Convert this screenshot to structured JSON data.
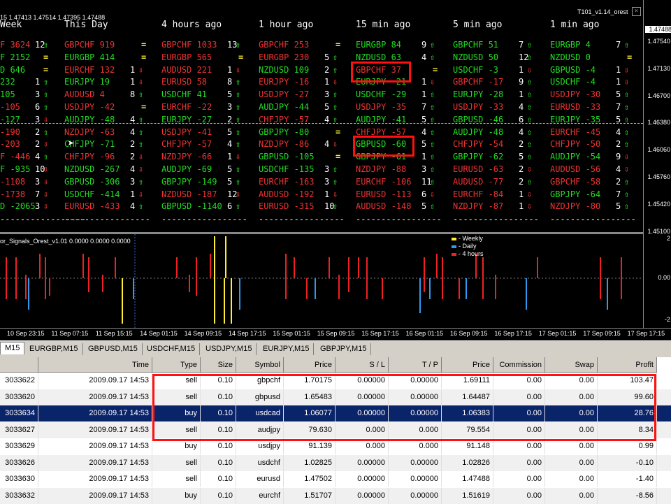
{
  "chart": {
    "quote_header": "15  1.47413 1.47514 1.47395 1.47488",
    "ea_name": "T101_v1.14_orest",
    "price_scale": [
      "1.47540",
      "1.47130",
      "1.46700",
      "1.46380",
      "1.46060",
      "1.45760",
      "1.45420",
      "1.45100"
    ],
    "current_price": "1.47488",
    "columns": [
      {
        "header": "Week",
        "rows": [
          {
            "pair": "F 3624",
            "dir": "down",
            "cnt": "12",
            "arrow": "up"
          },
          {
            "pair": "F 2152",
            "dir": "up",
            "cnt": "",
            "arrow": "eq"
          },
          {
            "pair": "D 646",
            "dir": "up",
            "cnt": "",
            "arrow": "eq"
          },
          {
            "pair": "232",
            "dir": "up",
            "cnt": "1",
            "arrow": "up"
          },
          {
            "pair": "105",
            "dir": "up",
            "cnt": "3",
            "arrow": "up"
          },
          {
            "pair": "-105",
            "dir": "down",
            "cnt": "6",
            "arrow": "up"
          },
          {
            "pair": "-127",
            "dbx": "",
            "dir": "up",
            "cnt": "3",
            "arrow": "down"
          },
          {
            "pair": "-190",
            "dir": "down",
            "cnt": "2",
            "arrow": "up"
          },
          {
            "pair": "-203",
            "dir": "down",
            "cnt": "2",
            "arrow": "down"
          },
          {
            "pair": "F -446",
            "dir": "down",
            "cnt": "4",
            "arrow": "up"
          },
          {
            "pair": "F -935",
            "dir": "up",
            "cnt": "10",
            "arrow": "down"
          },
          {
            "pair": "-1108",
            "dir": "down",
            "cnt": "3",
            "arrow": "down"
          },
          {
            "pair": "-1738",
            "dir": "down",
            "cnt": "7",
            "arrow": "down"
          },
          {
            "pair": "D -2065",
            "dir": "up",
            "cnt": "3",
            "arrow": "down"
          }
        ]
      },
      {
        "header": "This Day",
        "rows": [
          {
            "pair": "GBPCHF 919",
            "dir": "down",
            "cnt": "",
            "arrow": "eq"
          },
          {
            "pair": "EURGBP 414",
            "dir": "up",
            "cnt": "",
            "arrow": "eq"
          },
          {
            "pair": "EURCHF 132",
            "dir": "down",
            "cnt": "1",
            "arrow": "down"
          },
          {
            "pair": "EURJPY 19",
            "dir": "up",
            "cnt": "1",
            "arrow": "down"
          },
          {
            "pair": "AUDUSD 4",
            "dir": "down",
            "cnt": "8",
            "arrow": "up"
          },
          {
            "pair": "USDJPY -42",
            "dir": "down",
            "cnt": "",
            "arrow": "eq"
          },
          {
            "pair": "AUDJPY -48",
            "dir": "up",
            "cnt": "4",
            "arrow": "up"
          },
          {
            "pair": "NZDJPY -63",
            "dir": "down",
            "cnt": "4",
            "arrow": "up"
          },
          {
            "pair": "CHFJPY -71",
            "dir": "up",
            "cnt": "2",
            "arrow": "up"
          },
          {
            "pair": "CHFJPY -96",
            "dir": "down",
            "cnt": "2",
            "arrow": "down"
          },
          {
            "pair": "NZDUSD -267",
            "dir": "up",
            "cnt": "4",
            "arrow": "down"
          },
          {
            "pair": "GBPUSD -306",
            "dir": "up",
            "cnt": "3",
            "arrow": "up"
          },
          {
            "pair": "USDCHF -414",
            "dir": "up",
            "cnt": "1",
            "arrow": "down"
          },
          {
            "pair": "EURUSD -433",
            "dir": "down",
            "cnt": "4",
            "arrow": "up"
          }
        ]
      },
      {
        "header": "4 hours ago",
        "rows": [
          {
            "pair": "GBPCHF 1033",
            "dir": "down",
            "cnt": "13",
            "arrow": "up"
          },
          {
            "pair": "EURGBP 565",
            "dir": "down",
            "cnt": "",
            "arrow": "eq"
          },
          {
            "pair": "AUDUSD 221",
            "dir": "down",
            "cnt": "1",
            "arrow": "down"
          },
          {
            "pair": "EURUSD 58",
            "dir": "down",
            "cnt": "8",
            "arrow": "up"
          },
          {
            "pair": "USDCHF 41",
            "dir": "up",
            "cnt": "5",
            "arrow": "up"
          },
          {
            "pair": "EURCHF -22",
            "dir": "down",
            "cnt": "3",
            "arrow": "up"
          },
          {
            "pair": "EURJPY -27",
            "dir": "up",
            "cnt": "2",
            "arrow": "up"
          },
          {
            "pair": "USDJPY -41",
            "dir": "down",
            "cnt": "5",
            "arrow": "up"
          },
          {
            "pair": "CHFJPY -57",
            "dir": "down",
            "cnt": "4",
            "arrow": "up"
          },
          {
            "pair": "NZDJPY -66",
            "dir": "down",
            "cnt": "1",
            "arrow": "down"
          },
          {
            "pair": "AUDJPY -69",
            "dir": "up",
            "cnt": "5",
            "arrow": "up"
          },
          {
            "pair": "GBPJPY -149",
            "dir": "up",
            "cnt": "5",
            "arrow": "up"
          },
          {
            "pair": "NZDUSD -187",
            "dir": "down",
            "cnt": "12",
            "arrow": "down"
          },
          {
            "pair": "GBPUSD -1140",
            "dir": "up",
            "cnt": "6",
            "arrow": "up"
          }
        ]
      },
      {
        "header": "1 hour ago",
        "rows": [
          {
            "pair": "GBPCHF 253",
            "dir": "down",
            "cnt": "",
            "arrow": "eq"
          },
          {
            "pair": "EURGBP 230",
            "dir": "down",
            "cnt": "5",
            "arrow": "up"
          },
          {
            "pair": "NZDUSD 109",
            "dir": "up",
            "cnt": "2",
            "arrow": "up"
          },
          {
            "pair": "EURJPY -16",
            "dir": "down",
            "cnt": "1",
            "arrow": "down"
          },
          {
            "pair": "USDJPY -27",
            "dir": "down",
            "cnt": "3",
            "arrow": "up"
          },
          {
            "pair": "AUDJPY -44",
            "dir": "up",
            "cnt": "5",
            "arrow": "up"
          },
          {
            "pair": "CHFJPY -57",
            "dir": "down",
            "cnt": "4",
            "arrow": "up"
          },
          {
            "pair": "GBPJPY -80",
            "dir": "up",
            "cnt": "",
            "arrow": "eq"
          },
          {
            "pair": "NZDJPY -86",
            "dir": "down",
            "cnt": "4",
            "arrow": "down"
          },
          {
            "pair": "GBPUSD -105",
            "dir": "up",
            "cnt": "",
            "arrow": "eq"
          },
          {
            "pair": "USDCHF -135",
            "dir": "up",
            "cnt": "3",
            "arrow": "up"
          },
          {
            "pair": "EURCHF -163",
            "dir": "down",
            "cnt": "3",
            "arrow": "up"
          },
          {
            "pair": "AUDUSD -192",
            "dir": "down",
            "cnt": "1",
            "arrow": "down"
          },
          {
            "pair": "EURUSD -315",
            "dir": "down",
            "cnt": "10",
            "arrow": "up"
          }
        ]
      },
      {
        "header": "15 min ago",
        "rows": [
          {
            "pair": "EURGBP 84",
            "dir": "up",
            "cnt": "9",
            "arrow": "up"
          },
          {
            "pair": "NZDUSD 63",
            "dir": "up",
            "cnt": "4",
            "arrow": "up"
          },
          {
            "pair": "GBPCHF 37",
            "dir": "down",
            "cnt": "",
            "arrow": "eq"
          },
          {
            "pair": "EURJPY -21",
            "dir": "up",
            "cnt": "1",
            "arrow": "down"
          },
          {
            "pair": "USDCHF -29",
            "dir": "up",
            "cnt": "1",
            "arrow": "up"
          },
          {
            "pair": "USDJPY -35",
            "dir": "down",
            "cnt": "7",
            "arrow": "up"
          },
          {
            "pair": "AUDJPY -41",
            "dir": "up",
            "cnt": "5",
            "arrow": "up"
          },
          {
            "pair": "CHFJPY -57",
            "dir": "down",
            "cnt": "4",
            "arrow": "up"
          },
          {
            "pair": "GBPUSD -60",
            "dir": "up",
            "cnt": "5",
            "arrow": "up"
          },
          {
            "pair": "GBPJPY -61",
            "dir": "up",
            "cnt": "1",
            "arrow": "up"
          },
          {
            "pair": "NZDJPY -88",
            "dir": "down",
            "cnt": "3",
            "arrow": "up"
          },
          {
            "pair": "EURCHF -106",
            "dir": "down",
            "cnt": "11",
            "arrow": "up"
          },
          {
            "pair": "EURUSD -113",
            "dir": "down",
            "cnt": "6",
            "arrow": "down"
          },
          {
            "pair": "AUDUSD -148",
            "dir": "down",
            "cnt": "5",
            "arrow": "up"
          }
        ]
      },
      {
        "header": "5 min ago",
        "rows": [
          {
            "pair": "GBPCHF 51",
            "dir": "up",
            "cnt": "7",
            "arrow": "up"
          },
          {
            "pair": "NZDUSD 50",
            "dir": "up",
            "cnt": "12",
            "arrow": "up"
          },
          {
            "pair": "USDCHF -3",
            "dir": "up",
            "cnt": "1",
            "arrow": "down"
          },
          {
            "pair": "GBPCHF -17",
            "dir": "down",
            "cnt": "9",
            "arrow": "up"
          },
          {
            "pair": "EURJPY -28",
            "dir": "up",
            "cnt": "1",
            "arrow": "up"
          },
          {
            "pair": "USDJPY -33",
            "dir": "down",
            "cnt": "4",
            "arrow": "up"
          },
          {
            "pair": "GBPUSD -46",
            "dir": "up",
            "cnt": "6",
            "arrow": "up"
          },
          {
            "pair": "AUDJPY -48",
            "dir": "up",
            "cnt": "4",
            "arrow": "up"
          },
          {
            "pair": "CHFJPY -54",
            "dir": "down",
            "cnt": "2",
            "arrow": "up"
          },
          {
            "pair": "GBPJPY -62",
            "dir": "up",
            "cnt": "5",
            "arrow": "up"
          },
          {
            "pair": "EURUSD -63",
            "dir": "down",
            "cnt": "2",
            "arrow": "down"
          },
          {
            "pair": "AUDUSD -77",
            "dir": "down",
            "cnt": "2",
            "arrow": "up"
          },
          {
            "pair": "EURCHF -84",
            "dir": "down",
            "cnt": "1",
            "arrow": "down"
          },
          {
            "pair": "NZDJPY -87",
            "dir": "down",
            "cnt": "1",
            "arrow": "down"
          }
        ]
      },
      {
        "header": "1 min ago",
        "rows": [
          {
            "pair": "EURGBP 4",
            "dir": "up",
            "cnt": "7",
            "arrow": "up"
          },
          {
            "pair": "NZDUSD 0",
            "dir": "up",
            "cnt": "",
            "arrow": "eq"
          },
          {
            "pair": "GBPUSD -4",
            "dir": "up",
            "cnt": "1",
            "arrow": "down"
          },
          {
            "pair": "USDCHF -4",
            "dir": "up",
            "cnt": "1",
            "arrow": "down"
          },
          {
            "pair": "USDJPY -30",
            "dir": "down",
            "cnt": "5",
            "arrow": "up"
          },
          {
            "pair": "EURUSD -33",
            "dir": "down",
            "cnt": "7",
            "arrow": "up"
          },
          {
            "pair": "EURJPY -35",
            "dir": "up",
            "cnt": "5",
            "arrow": "up"
          },
          {
            "pair": "EURCHF -45",
            "dir": "down",
            "cnt": "4",
            "arrow": "up"
          },
          {
            "pair": "CHFJPY -50",
            "dir": "down",
            "cnt": "2",
            "arrow": "up"
          },
          {
            "pair": "AUDJPY -54",
            "dir": "up",
            "cnt": "9",
            "arrow": "down"
          },
          {
            "pair": "AUDUSD -56",
            "dir": "down",
            "cnt": "4",
            "arrow": "down"
          },
          {
            "pair": "GBPCHF -58",
            "dir": "down",
            "cnt": "2",
            "arrow": "up"
          },
          {
            "pair": "GBPJPY -64",
            "dir": "up",
            "cnt": "7",
            "arrow": "up"
          },
          {
            "pair": "NZDJPY -80",
            "dir": "down",
            "cnt": "5",
            "arrow": "up"
          }
        ]
      }
    ],
    "dashes": "-----------------"
  },
  "indicator": {
    "title": "or_Signals_Orest_v1.01 0.0000 0.0000 0.0000",
    "legend": [
      {
        "label": "- Weekly",
        "color": "#ffee33"
      },
      {
        "label": "- Daily",
        "color": "#3399ee"
      },
      {
        "label": "- 4 hours",
        "color": "#ee2222"
      }
    ],
    "scale": [
      "2",
      "0.00",
      "-2"
    ]
  },
  "time_axis": [
    "10 Sep 23:15",
    "11 Sep 07:15",
    "11 Sep 15:15",
    "14 Sep 01:15",
    "14 Sep 09:15",
    "14 Sep 17:15",
    "15 Sep 01:15",
    "15 Sep 09:15",
    "15 Sep 17:15",
    "16 Sep 01:15",
    "16 Sep 09:15",
    "16 Sep 17:15",
    "17 Sep 01:15",
    "17 Sep 09:15",
    "17 Sep 17:15"
  ],
  "tabs": [
    "M15",
    "EURGBP,M15",
    "GBPUSD,M15",
    "USDCHF,M15",
    "USDJPY,M15",
    "EURJPY,M15",
    "GBPJPY,M15"
  ],
  "orders": {
    "headers": [
      "",
      "Time",
      "Type",
      "Size",
      "Symbol",
      "Price",
      "S / L",
      "T / P",
      "Price",
      "Commission",
      "Swap",
      "Profit"
    ],
    "rows": [
      [
        "3033622",
        "2009.09.17 14:53",
        "sell",
        "0.10",
        "gbpchf",
        "1.70175",
        "0.00000",
        "0.00000",
        "1.69111",
        "0.00",
        "0.00",
        "103.47"
      ],
      [
        "3033620",
        "2009.09.17 14:53",
        "sell",
        "0.10",
        "gbpusd",
        "1.65483",
        "0.00000",
        "0.00000",
        "1.64487",
        "0.00",
        "0.00",
        "99.60"
      ],
      [
        "3033634",
        "2009.09.17 14:53",
        "buy",
        "0.10",
        "usdcad",
        "1.06077",
        "0.00000",
        "0.00000",
        "1.06383",
        "0.00",
        "0.00",
        "28.76"
      ],
      [
        "3033627",
        "2009.09.17 14:53",
        "sell",
        "0.10",
        "audjpy",
        "79.630",
        "0.000",
        "0.000",
        "79.554",
        "0.00",
        "0.00",
        "8.34"
      ],
      [
        "3033629",
        "2009.09.17 14:53",
        "buy",
        "0.10",
        "usdjpy",
        "91.139",
        "0.000",
        "0.000",
        "91.148",
        "0.00",
        "0.00",
        "0.99"
      ],
      [
        "3033626",
        "2009.09.17 14:53",
        "sell",
        "0.10",
        "usdchf",
        "1.02825",
        "0.00000",
        "0.00000",
        "1.02826",
        "0.00",
        "0.00",
        "-0.10"
      ],
      [
        "3033630",
        "2009.09.17 14:53",
        "sell",
        "0.10",
        "eurusd",
        "1.47502",
        "0.00000",
        "0.00000",
        "1.47488",
        "0.00",
        "0.00",
        "-1.40"
      ],
      [
        "3033632",
        "2009.09.17 14:53",
        "buy",
        "0.10",
        "eurchf",
        "1.51707",
        "0.00000",
        "0.00000",
        "1.51619",
        "0.00",
        "0.00",
        "-8.56"
      ]
    ],
    "selected_row": 2
  },
  "colors": {
    "up": "#22dd22",
    "down": "#ee3333",
    "eq": "#ffee33",
    "highlight": "#ff1111",
    "selection": "#0a246a"
  }
}
